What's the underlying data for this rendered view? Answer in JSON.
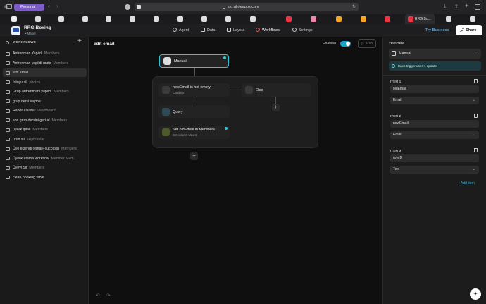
{
  "browser": {
    "profile": "Personal",
    "url": "go.glideapps.com",
    "active_tab": "RRG Bo..."
  },
  "app": {
    "name": "RRG Boxing",
    "role": "Maker",
    "nav": [
      "Agent",
      "Data",
      "Layout",
      "Workflows",
      "Settings"
    ],
    "try_business": "Try Business",
    "share": "Share"
  },
  "sidebar": {
    "title": "WORKFLOWS",
    "items": [
      {
        "label": "Antrenman Yapildi",
        "sub": "Members"
      },
      {
        "label": "Antrenman yapildi undo",
        "sub": "Members"
      },
      {
        "label": "edit email",
        "sub": ""
      },
      {
        "label": "fotoyu sil",
        "sub": "photos"
      },
      {
        "label": "Grup antrenmani yapildi",
        "sub": "Members"
      },
      {
        "label": "grup dersi sayma",
        "sub": ""
      },
      {
        "label": "Rapor Olustur",
        "sub": "Dashboard"
      },
      {
        "label": "son grup dersini geri al",
        "sub": "Members"
      },
      {
        "label": "uyelik iptali",
        "sub": "Members"
      },
      {
        "label": "ürün sil",
        "sub": "ekipmanlar"
      },
      {
        "label": "Üye eklendi (email+success)",
        "sub": "Members"
      },
      {
        "label": "Üyelik atama workflow",
        "sub": "Member Mem..."
      },
      {
        "label": "Üyeyi Sil",
        "sub": "Members"
      },
      {
        "label": "clean booking table",
        "sub": ""
      }
    ]
  },
  "canvas": {
    "title": "edit email",
    "enabled_label": "Enabled",
    "run_label": "Run",
    "nodes": {
      "manual": "Manual",
      "condition_title": "newEmail is not empty",
      "condition_sub": "Condition",
      "else": "Else",
      "query": "Query",
      "set_title": "Set oldEmail in Members",
      "set_sub": "Set column values"
    }
  },
  "panel": {
    "title": "TRIGGER",
    "trigger_value": "Manual",
    "info": "Each trigger uses 1 update",
    "items": [
      {
        "label": "ITEM 1",
        "name": "oldEmail",
        "type": "Email"
      },
      {
        "label": "ITEM 2",
        "name": "newEmail",
        "type": "Email"
      },
      {
        "label": "ITEM 3",
        "name": "rowID",
        "type": "Text"
      }
    ],
    "add_item": "+ Add item"
  }
}
